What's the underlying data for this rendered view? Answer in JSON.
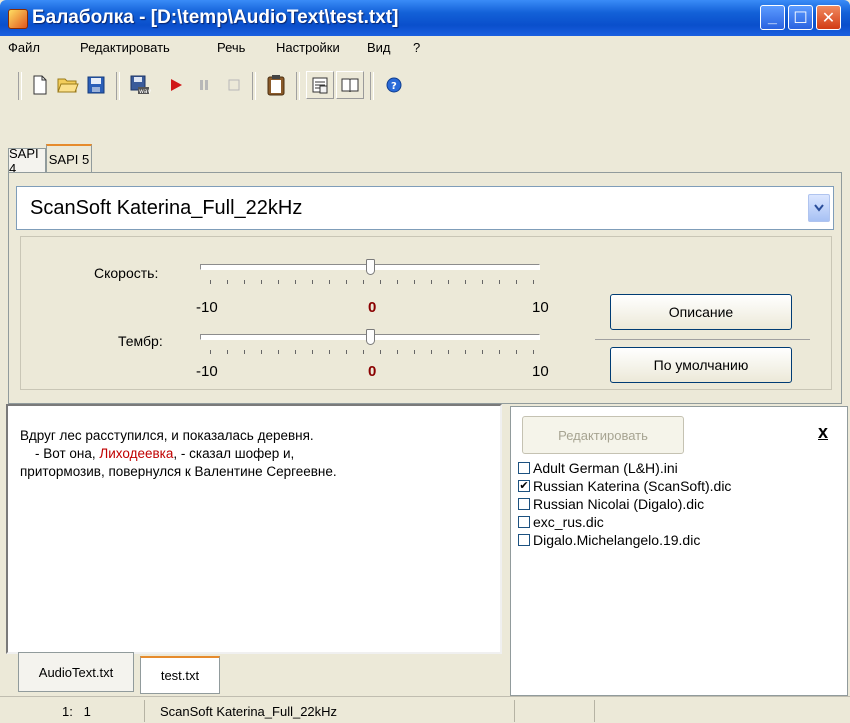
{
  "window": {
    "title": "Балаболка - [D:\\temp\\AudioText\\test.txt]",
    "minimize_glyph": "_",
    "maximize_glyph": "☐",
    "close_glyph": "✕"
  },
  "menu": [
    "Файл",
    "Редактировать",
    "Речь",
    "Настройки",
    "Вид",
    "?"
  ],
  "toolbar": {
    "icons": [
      "new-file-icon",
      "open-folder-icon",
      "save-icon",
      "save-audio-icon",
      "play-icon",
      "pause-icon",
      "stop-icon",
      "clipboard-icon",
      "properties-icon",
      "book-icon",
      "help-icon"
    ]
  },
  "engine_tabs": [
    "SAPI 4",
    "SAPI 5"
  ],
  "voice": {
    "selected": "ScanSoft Katerina_Full_22kHz"
  },
  "sliders": {
    "speed": {
      "label": "Скорость:",
      "min": "-10",
      "mid": "0",
      "max": "10",
      "value": 0
    },
    "pitch": {
      "label": "Тембр:",
      "min": "-10",
      "mid": "0",
      "max": "10",
      "value": 0
    }
  },
  "buttons": {
    "description": "Описание",
    "defaults": "По умолчанию",
    "edit": "Редактировать",
    "close": "x"
  },
  "editor": {
    "line1": "Вдруг лес расступился, и показалась деревня.",
    "line2_a": "    - Вот она, ",
    "line2_highlight": "Лиходеевка",
    "line2_b": ", - сказал шофер и,",
    "line3": "притормозив, повернулся к Валентине Сергеевне."
  },
  "dictionaries": [
    {
      "name": "Adult German (L&H).ini",
      "checked": false
    },
    {
      "name": "Russian Katerina (ScanSoft).dic",
      "checked": true
    },
    {
      "name": "Russian Nicolai (Digalo).dic",
      "checked": false
    },
    {
      "name": "exc_rus.dic",
      "checked": false
    },
    {
      "name": "Digalo.Michelangelo.19.dic",
      "checked": false
    }
  ],
  "file_tabs": [
    "AudioText.txt",
    "test.txt"
  ],
  "status": {
    "position": "1:   1",
    "voice": "ScanSoft Katerina_Full_22kHz"
  },
  "colors": {
    "highlight_word": "#c00000",
    "tick_mid": "#8a0000"
  }
}
